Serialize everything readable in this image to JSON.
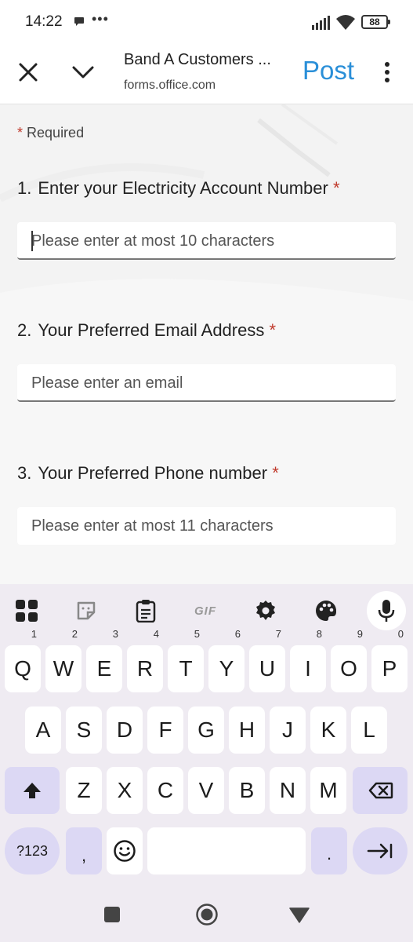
{
  "status_bar": {
    "time": "14:22",
    "more": "•••",
    "battery": "88"
  },
  "header": {
    "title": "Band A Customers ...",
    "url": "forms.office.com",
    "post_label": "Post"
  },
  "form": {
    "required_star": "*",
    "required_label": "Required",
    "questions": [
      {
        "number": "1.",
        "label": "Enter your Electricity Account Number",
        "star": "*",
        "placeholder": "Please enter at most 10 characters"
      },
      {
        "number": "2.",
        "label": "Your Preferred Email Address",
        "star": "*",
        "placeholder": "Please enter an email"
      },
      {
        "number": "3.",
        "label": "Your Preferred Phone number",
        "star": "*",
        "placeholder": "Please enter at most 11 characters"
      }
    ]
  },
  "keyboard": {
    "toolbar_icons": [
      "apps-grid-icon",
      "sticker-icon",
      "clipboard-icon",
      "gif-icon",
      "settings-gear-icon",
      "theme-palette-icon",
      "microphone-icon"
    ],
    "gif_label": "GIF",
    "row1": [
      {
        "key": "Q",
        "hint": "1"
      },
      {
        "key": "W",
        "hint": "2"
      },
      {
        "key": "E",
        "hint": "3"
      },
      {
        "key": "R",
        "hint": "4"
      },
      {
        "key": "T",
        "hint": "5"
      },
      {
        "key": "Y",
        "hint": "6"
      },
      {
        "key": "U",
        "hint": "7"
      },
      {
        "key": "I",
        "hint": "8"
      },
      {
        "key": "O",
        "hint": "9"
      },
      {
        "key": "P",
        "hint": "0"
      }
    ],
    "row2": [
      "A",
      "S",
      "D",
      "F",
      "G",
      "H",
      "J",
      "K",
      "L"
    ],
    "row3": [
      "Z",
      "X",
      "C",
      "V",
      "B",
      "N",
      "M"
    ],
    "numsym_label": "?123",
    "comma_label": ",",
    "period_label": "."
  },
  "colors": {
    "accent": "#2a8fd8",
    "required": "#c0392b",
    "keyboard_bg": "#efebf2",
    "modifier_key": "#dcd8f4"
  }
}
